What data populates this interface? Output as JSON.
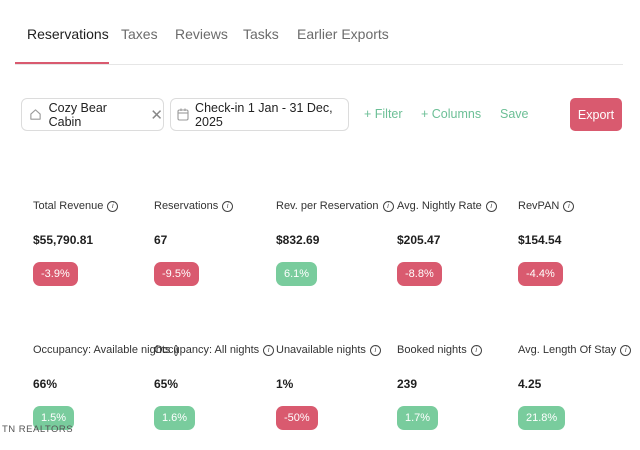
{
  "tabs": [
    {
      "label": "Reservations",
      "active": true
    },
    {
      "label": "Taxes"
    },
    {
      "label": "Reviews"
    },
    {
      "label": "Tasks"
    },
    {
      "label": "Earlier Exports"
    }
  ],
  "filters": {
    "property": "Cozy Bear Cabin",
    "date_range": "Check-in 1 Jan - 31 Dec, 2025",
    "add_filter": "+ Filter",
    "add_columns": "+ Columns",
    "save": "Save",
    "export": "Export"
  },
  "metrics": [
    {
      "label": "Total Revenue",
      "value": "$55,790.81",
      "change": "-3.9%",
      "trend": "negative"
    },
    {
      "label": "Reservations",
      "value": "67",
      "change": "-9.5%",
      "trend": "negative"
    },
    {
      "label": "Rev. per Reservation",
      "value": "$832.69",
      "change": "6.1%",
      "trend": "positive"
    },
    {
      "label": "Avg. Nightly Rate",
      "value": "$205.47",
      "change": "-8.8%",
      "trend": "negative"
    },
    {
      "label": "RevPAN",
      "value": "$154.54",
      "change": "-4.4%",
      "trend": "negative"
    },
    {
      "label": "Occupancy: Available nights",
      "value": "66%",
      "change": "1.5%",
      "trend": "positive"
    },
    {
      "label": "Occupancy: All nights",
      "value": "65%",
      "change": "1.6%",
      "trend": "positive"
    },
    {
      "label": "Unavailable nights",
      "value": "1%",
      "change": "-50%",
      "trend": "negative"
    },
    {
      "label": "Booked nights",
      "value": "239",
      "change": "1.7%",
      "trend": "positive"
    },
    {
      "label": "Avg. Length Of Stay",
      "value": "4.25",
      "change": "21.8%",
      "trend": "positive"
    }
  ],
  "colors": {
    "accent": "#d95a6f",
    "positive": "#79cc9d",
    "link": "#6cbf96"
  },
  "watermark": "TN REALTORS"
}
